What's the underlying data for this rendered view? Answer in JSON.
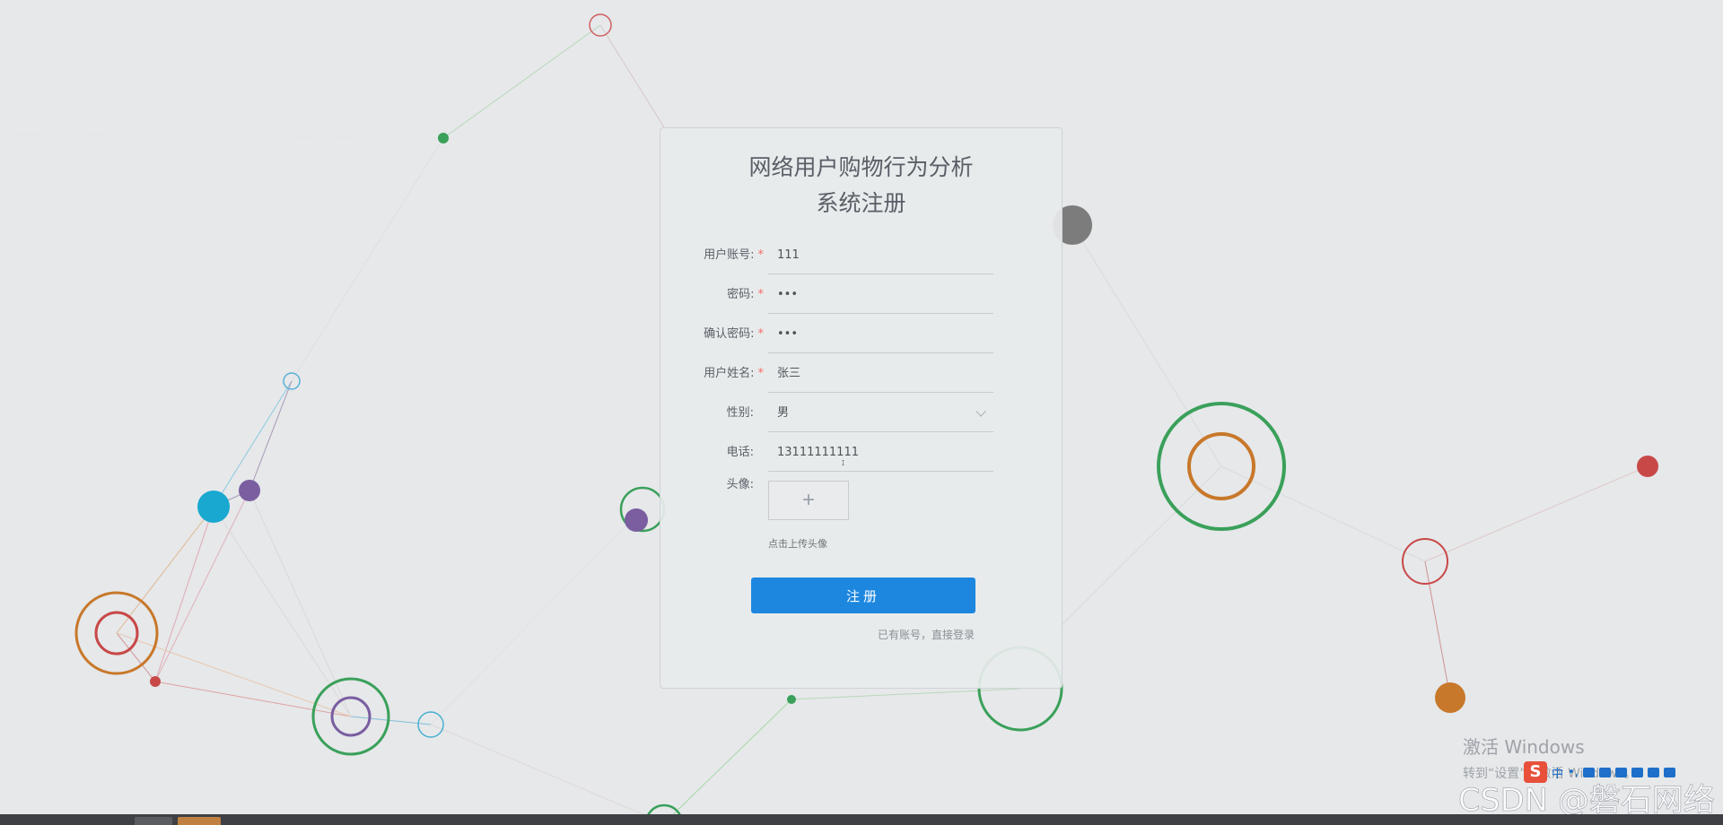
{
  "page": {
    "title_line1": "网络用户购物行为分析",
    "title_line2": "系统注册"
  },
  "form": {
    "fields": [
      {
        "label": "用户账号:",
        "required": true,
        "value": "111"
      },
      {
        "label": "密码:",
        "required": true,
        "value": "•••"
      },
      {
        "label": "确认密码:",
        "required": true,
        "value": "•••"
      },
      {
        "label": "用户姓名:",
        "required": true,
        "value": "张三"
      },
      {
        "label": "性别:",
        "required": false,
        "value": "男"
      },
      {
        "label": "电话:",
        "required": false,
        "value": "13111111111"
      }
    ],
    "avatar": {
      "label": "头像:",
      "plus": "+",
      "hint": "点击上传头像"
    },
    "required_mark": "*",
    "submit_label": "注册",
    "login_link": "已有账号，直接登录"
  },
  "watermark": {
    "title": "激活 Windows",
    "subtitle": "转到“设置”以激活 Windows。",
    "csdn": "CSDN @磐石网络"
  },
  "ime": {
    "logo": "S",
    "mode": "中",
    "punct": "•,"
  },
  "colors": {
    "background": "#e6e8ea",
    "primary_button": "#1d87e0",
    "required_star": "#f56c6c",
    "node_green": "#3aa05a",
    "node_orange": "#c8782a",
    "node_red": "#c84848",
    "node_purple": "#7a5ea0",
    "node_cyan": "#18a8d0",
    "node_gray": "#808080"
  }
}
